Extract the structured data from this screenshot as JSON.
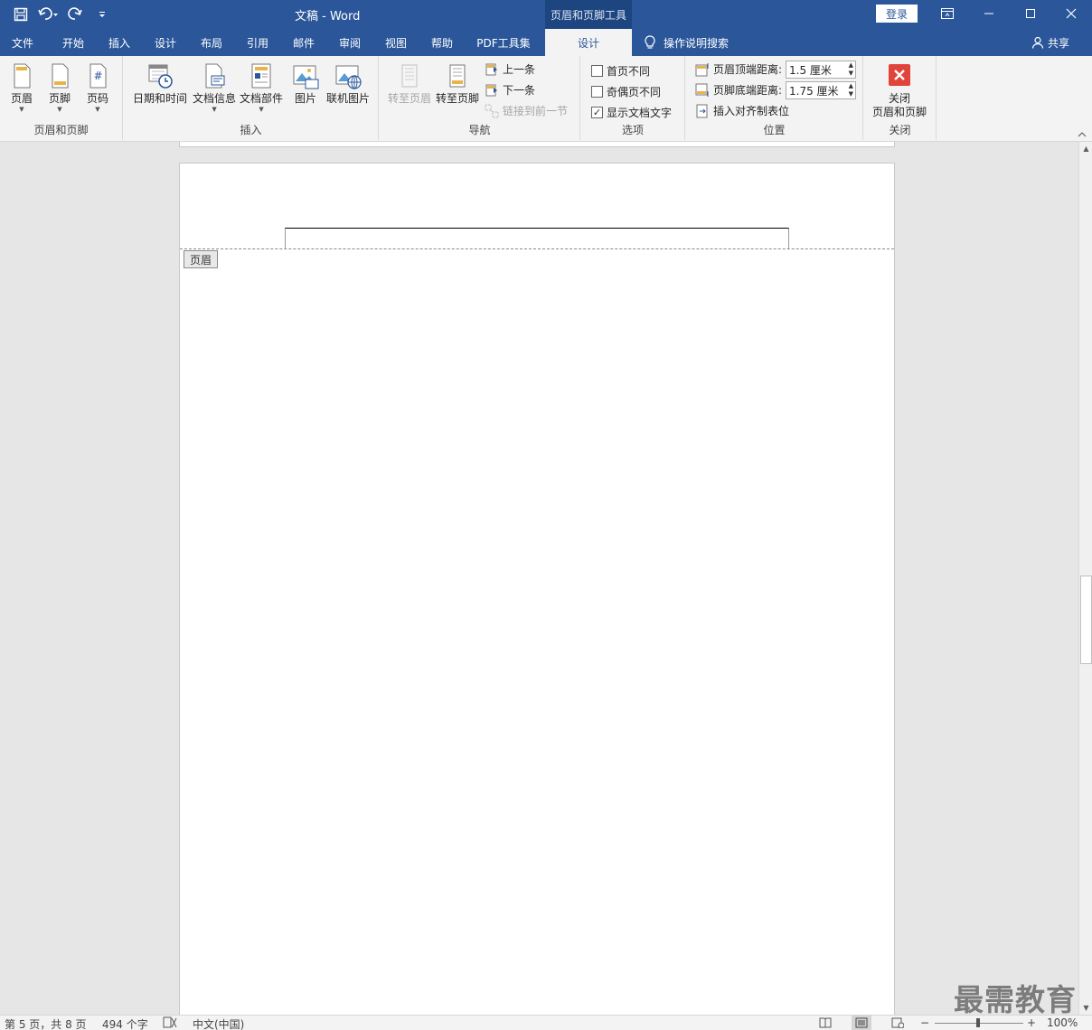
{
  "titlebar": {
    "doc_title": "文稿  -  Word",
    "context_title": "页眉和页脚工具",
    "login": "登录"
  },
  "tabs": [
    {
      "label": "文件"
    },
    {
      "label": "开始"
    },
    {
      "label": "插入"
    },
    {
      "label": "设计"
    },
    {
      "label": "布局"
    },
    {
      "label": "引用"
    },
    {
      "label": "邮件"
    },
    {
      "label": "审阅"
    },
    {
      "label": "视图"
    },
    {
      "label": "帮助"
    },
    {
      "label": "PDF工具集"
    },
    {
      "label": "设计",
      "active": true
    }
  ],
  "tellme": "操作说明搜索",
  "share": "共享",
  "ribbon": {
    "group_header_footer": {
      "label": "页眉和页脚",
      "header": "页眉",
      "footer": "页脚",
      "page_number": "页码"
    },
    "group_insert": {
      "label": "插入",
      "datetime": "日期和时间",
      "docinfo": "文档信息",
      "quickparts": "文档部件",
      "picture": "图片",
      "online_picture": "联机图片"
    },
    "group_nav": {
      "label": "导航",
      "goto_header": "转至页眉",
      "goto_footer": "转至页脚",
      "previous": "上一条",
      "next": "下一条",
      "link_previous": "链接到前一节"
    },
    "group_options": {
      "label": "选项",
      "different_first": "首页不同",
      "different_odd_even": "奇偶页不同",
      "show_doc_text": "显示文档文字"
    },
    "group_position": {
      "label": "位置",
      "header_from_top_label": "页眉顶端距离:",
      "header_from_top_value": "1.5 厘米",
      "footer_from_bottom_label": "页脚底端距离:",
      "footer_from_bottom_value": "1.75 厘米",
      "insert_align_tab": "插入对齐制表位"
    },
    "group_close": {
      "label": "关闭",
      "close_line1": "关闭",
      "close_line2": "页眉和页脚"
    }
  },
  "document": {
    "header_tag": "页眉"
  },
  "status": {
    "page": "第 5 页，共 8 页",
    "words": "494 个字",
    "language": "中文(中国)",
    "zoom": "100%"
  },
  "watermark": "最需教育",
  "colors": {
    "accent": "#2b579a",
    "ribbon_bg": "#f3f3f3",
    "close_red": "#e0443a"
  }
}
